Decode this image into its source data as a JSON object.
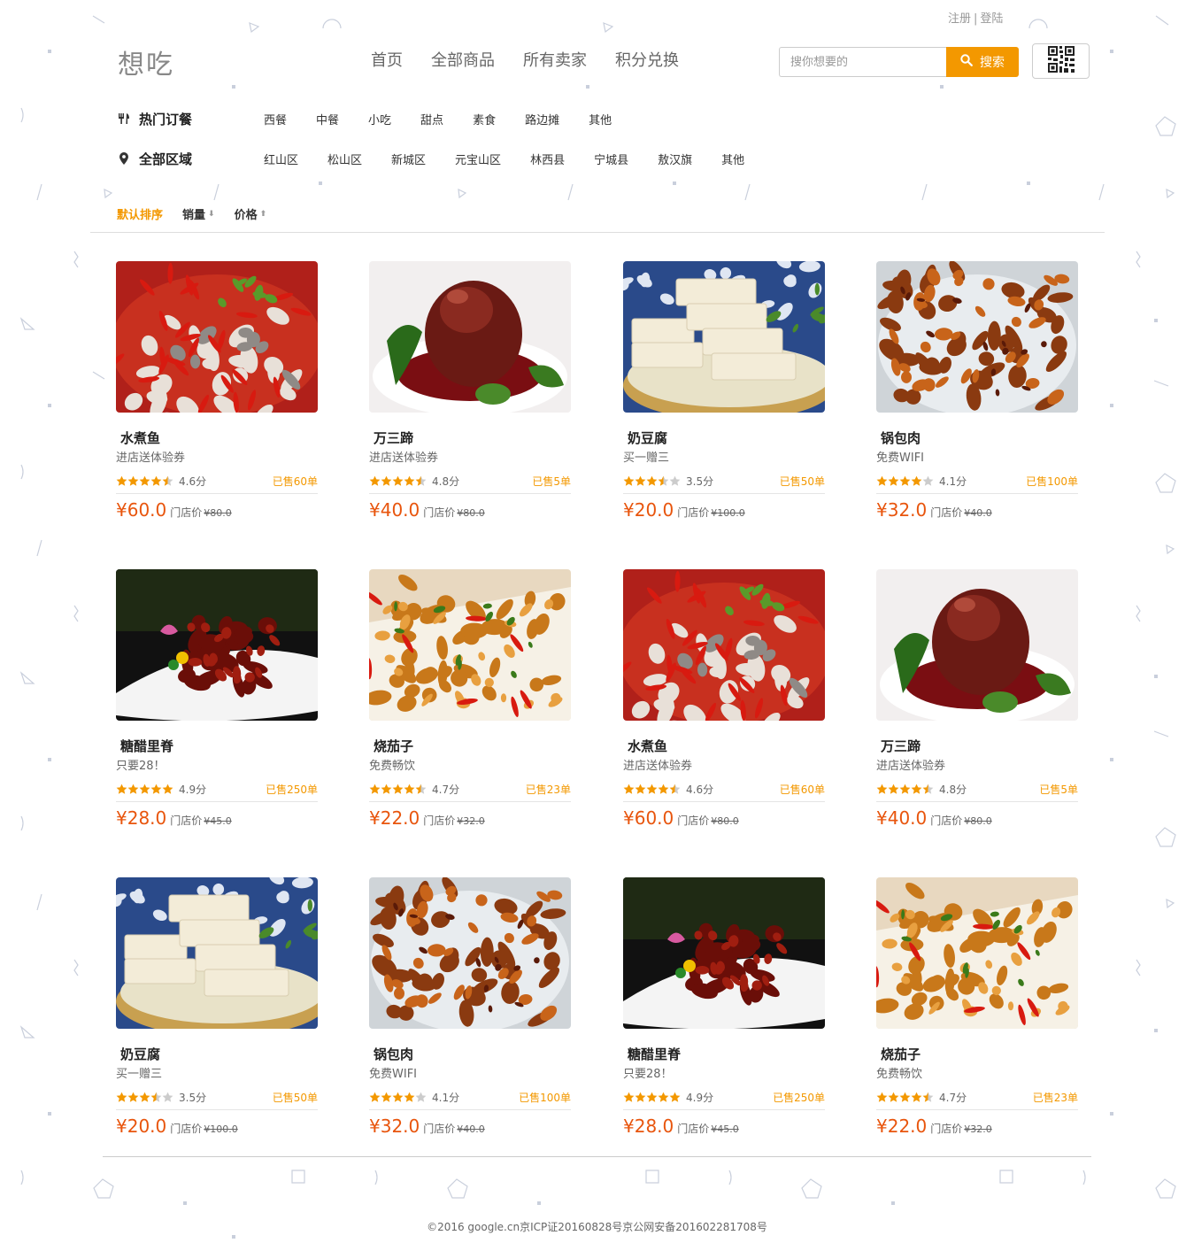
{
  "account": {
    "register": "注册",
    "separator": "|",
    "login": "登陆"
  },
  "logo": "想吃",
  "nav": [
    "首页",
    "全部商品",
    "所有卖家",
    "积分兑换"
  ],
  "search": {
    "placeholder": "搜你想要的",
    "button": "搜索"
  },
  "filters": {
    "category": {
      "title": "热门订餐",
      "icon": "utensils-icon",
      "items": [
        "西餐",
        "中餐",
        "小吃",
        "甜点",
        "素食",
        "路边摊",
        "其他"
      ]
    },
    "area": {
      "title": "全部区域",
      "icon": "location-pin-icon",
      "items": [
        "红山区",
        "松山区",
        "新城区",
        "元宝山区",
        "林西县",
        "宁城县",
        "敖汉旗",
        "其他"
      ]
    }
  },
  "sort": {
    "default": "默认排序",
    "sales": "销量",
    "price": "价格"
  },
  "products": [
    {
      "name": "水煮鱼",
      "promo": "进店送体验券",
      "stars": 4.5,
      "score": "4.6分",
      "sold": "已售60单",
      "price": "¥60.0",
      "store_label": "门店价",
      "orig": "¥80.0",
      "image": "spicy-fish"
    },
    {
      "name": "万三蹄",
      "promo": "进店送体验券",
      "stars": 4.5,
      "score": "4.8分",
      "sold": "已售5单",
      "price": "¥40.0",
      "store_label": "门店价",
      "orig": "¥80.0",
      "image": "pork-knuckle"
    },
    {
      "name": "奶豆腐",
      "promo": "买一赠三",
      "stars": 3.5,
      "score": "3.5分",
      "sold": "已售50单",
      "price": "¥20.0",
      "store_label": "门店价",
      "orig": "¥100.0",
      "image": "milk-tofu"
    },
    {
      "name": "锅包肉",
      "promo": "免费WIFI",
      "stars": 4,
      "score": "4.1分",
      "sold": "已售100单",
      "price": "¥32.0",
      "store_label": "门店价",
      "orig": "¥40.0",
      "image": "guobaorou"
    },
    {
      "name": "糖醋里脊",
      "promo": "只要28！",
      "stars": 5,
      "score": "4.9分",
      "sold": "已售250单",
      "price": "¥28.0",
      "store_label": "门店价",
      "orig": "¥45.0",
      "image": "sweet-sour-pork"
    },
    {
      "name": "烧茄子",
      "promo": "免费畅饮",
      "stars": 4.5,
      "score": "4.7分",
      "sold": "已售23单",
      "price": "¥22.0",
      "store_label": "门店价",
      "orig": "¥32.0",
      "image": "braised-eggplant"
    },
    {
      "name": "水煮鱼",
      "promo": "进店送体验券",
      "stars": 4.5,
      "score": "4.6分",
      "sold": "已售60单",
      "price": "¥60.0",
      "store_label": "门店价",
      "orig": "¥80.0",
      "image": "spicy-fish"
    },
    {
      "name": "万三蹄",
      "promo": "进店送体验券",
      "stars": 4.5,
      "score": "4.8分",
      "sold": "已售5单",
      "price": "¥40.0",
      "store_label": "门店价",
      "orig": "¥80.0",
      "image": "pork-knuckle"
    },
    {
      "name": "奶豆腐",
      "promo": "买一赠三",
      "stars": 3.5,
      "score": "3.5分",
      "sold": "已售50单",
      "price": "¥20.0",
      "store_label": "门店价",
      "orig": "¥100.0",
      "image": "milk-tofu"
    },
    {
      "name": "锅包肉",
      "promo": "免费WIFI",
      "stars": 4,
      "score": "4.1分",
      "sold": "已售100单",
      "price": "¥32.0",
      "store_label": "门店价",
      "orig": "¥40.0",
      "image": "guobaorou"
    },
    {
      "name": "糖醋里脊",
      "promo": "只要28！",
      "stars": 5,
      "score": "4.9分",
      "sold": "已售250单",
      "price": "¥28.0",
      "store_label": "门店价",
      "orig": "¥45.0",
      "image": "sweet-sour-pork"
    },
    {
      "name": "烧茄子",
      "promo": "免费畅饮",
      "stars": 4.5,
      "score": "4.7分",
      "sold": "已售23单",
      "price": "¥22.0",
      "store_label": "门店价",
      "orig": "¥32.0",
      "image": "braised-eggplant"
    }
  ],
  "footer": "©2016 google.cn京ICP证20160828号京公网安备201602281708号",
  "colors": {
    "accent": "#f39800",
    "price": "#e8550d"
  }
}
